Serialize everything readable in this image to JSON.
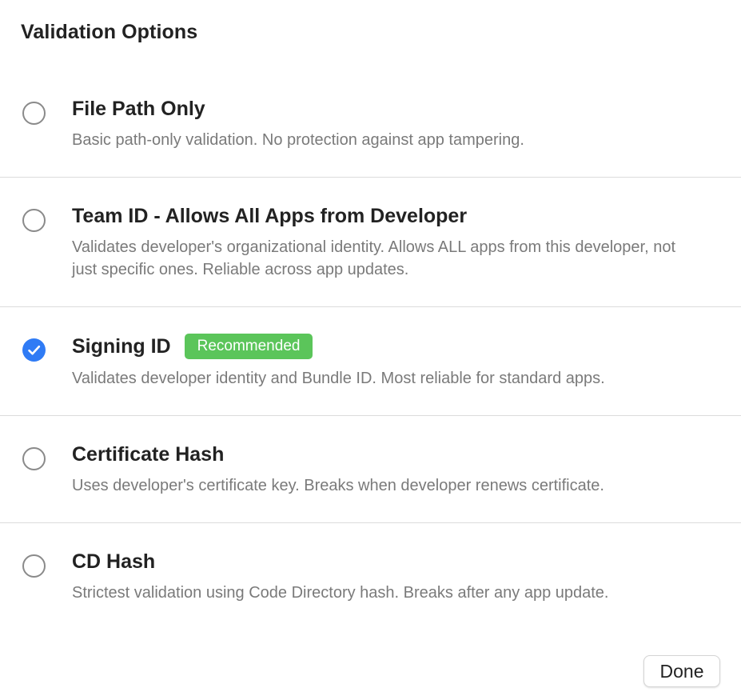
{
  "dialog": {
    "title": "Validation Options"
  },
  "options": [
    {
      "label": "File Path Only",
      "description": "Basic path-only validation. No protection against app tampering.",
      "selected": false
    },
    {
      "label": "Team ID - Allows All Apps from Developer",
      "description": "Validates developer's organizational identity. Allows ALL apps from this developer, not just specific ones. Reliable across app updates.",
      "selected": false
    },
    {
      "label": "Signing ID",
      "badge": "Recommended",
      "description": "Validates developer identity and Bundle ID. Most reliable for standard apps.",
      "selected": true
    },
    {
      "label": "Certificate Hash",
      "description": "Uses developer's certificate key. Breaks when developer renews certificate.",
      "selected": false
    },
    {
      "label": "CD Hash",
      "description": "Strictest validation using Code Directory hash. Breaks after any app update.",
      "selected": false
    }
  ],
  "footer": {
    "done_label": "Done"
  },
  "colors": {
    "accent": "#2f7bf5",
    "badge": "#5bc55a",
    "divider": "#dcdcdc",
    "secondary_text": "#7a7a7a"
  },
  "icons": {
    "radio_checked": "checkmark-icon"
  }
}
